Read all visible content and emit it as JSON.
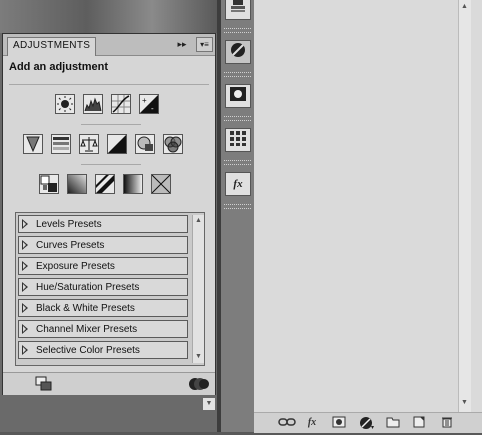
{
  "adjustments_panel": {
    "tab_label": "ADJUSTMENTS",
    "collapse_glyph": "▸▸",
    "menu_glyph": "▾≡",
    "heading": "Add an adjustment",
    "icon_rows": [
      [
        "brightness-contrast-icon",
        "levels-icon",
        "curves-icon",
        "exposure-icon"
      ],
      [
        "vibrance-icon",
        "hue-saturation-icon",
        "color-balance-icon",
        "black-white-icon",
        "photo-filter-icon",
        "channel-mixer-icon"
      ],
      [
        "invert-icon",
        "posterize-icon",
        "threshold-icon",
        "gradient-map-icon",
        "selective-color-icon"
      ]
    ],
    "presets": [
      "Levels Presets",
      "Curves Presets",
      "Exposure Presets",
      "Hue/Saturation Presets",
      "Black & White Presets",
      "Channel Mixer Presets",
      "Selective Color Presets"
    ]
  },
  "right_panel": {
    "footer_buttons": [
      "link-icon",
      "fx",
      "mask-icon",
      "adjustment-layer-icon",
      "folder-icon",
      "new-layer-icon",
      "trash-icon"
    ],
    "fx_label": "fx"
  },
  "dock": {
    "fx_label": "fx"
  }
}
